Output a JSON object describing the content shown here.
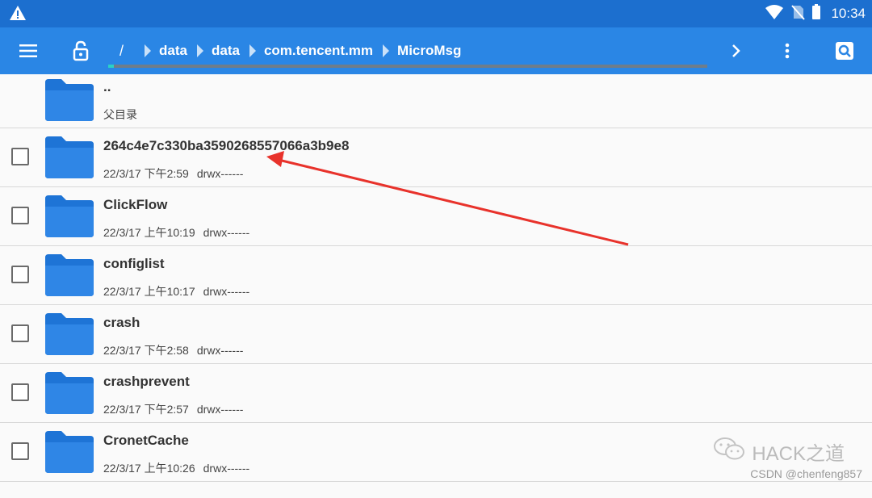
{
  "status_bar": {
    "time": "10:34",
    "icons": [
      "warning-icon",
      "wifi-icon",
      "no-sim-icon",
      "battery-icon"
    ]
  },
  "toolbar": {
    "icons": [
      "menu-icon",
      "unlock-icon",
      "chevron-right-icon",
      "more-vert-icon",
      "search-icon"
    ],
    "breadcrumb": [
      "/",
      "data",
      "data",
      "com.tencent.mm",
      "MicroMsg"
    ],
    "progress": 0.01
  },
  "files": [
    {
      "name": "..",
      "subtitle": "父目录",
      "date": "",
      "perm": "",
      "checkbox": false
    },
    {
      "name": "264c4e7c330ba3590268557066a3b9e8",
      "subtitle": "",
      "date": "22/3/17 下午2:59",
      "perm": "drwx------",
      "checkbox": true
    },
    {
      "name": "ClickFlow",
      "subtitle": "",
      "date": "22/3/17 上午10:19",
      "perm": "drwx------",
      "checkbox": true
    },
    {
      "name": "configlist",
      "subtitle": "",
      "date": "22/3/17 上午10:17",
      "perm": "drwx------",
      "checkbox": true
    },
    {
      "name": "crash",
      "subtitle": "",
      "date": "22/3/17 下午2:58",
      "perm": "drwx------",
      "checkbox": true
    },
    {
      "name": "crashprevent",
      "subtitle": "",
      "date": "22/3/17 下午2:57",
      "perm": "drwx------",
      "checkbox": true
    },
    {
      "name": "CronetCache",
      "subtitle": "",
      "date": "22/3/17 上午10:26",
      "perm": "drwx------",
      "checkbox": true
    }
  ],
  "watermark": {
    "text": "HACK之道",
    "credit": "CSDN @chenfeng857"
  },
  "colors": {
    "status_bar": "#1c6fcf",
    "toolbar": "#2a86e5",
    "folder": "#1e74d6",
    "annotation_arrow": "#e8322b"
  }
}
